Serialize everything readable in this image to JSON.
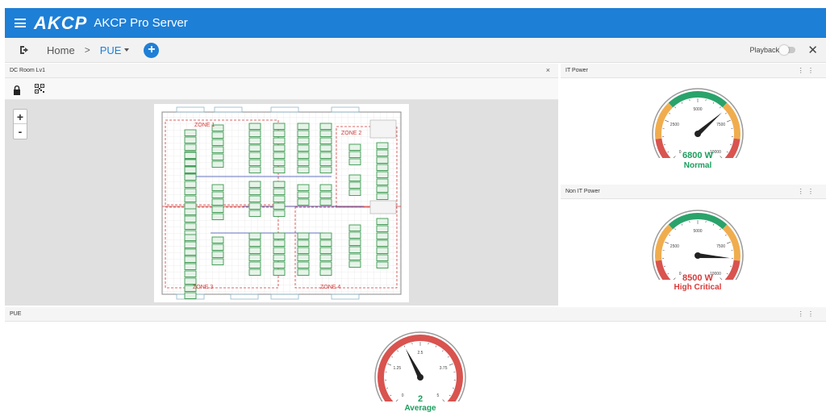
{
  "header": {
    "brand": "AKCP",
    "title": "AKCP Pro Server"
  },
  "nav": {
    "home": "Home",
    "separator": ">",
    "current": "PUE",
    "add_symbol": "+",
    "playback_label": "Playback",
    "close_symbol": "✕"
  },
  "map_panel": {
    "title": "DC Room Lv1",
    "close_symbol": "×",
    "zoom_in": "+",
    "zoom_out": "-",
    "zones": [
      "ZONE 1",
      "ZONE 2",
      "ZONE 3",
      "ZONE 4"
    ]
  },
  "it_power": {
    "title": "IT Power",
    "menu": "⋮ ⋮",
    "value_text": "6800 W",
    "status": "Normal",
    "value": 6800,
    "min": 0,
    "max": 10000,
    "ticks": [
      "0",
      "2500",
      "5000",
      "7500",
      "10000"
    ],
    "color_value": "#1a9e5c"
  },
  "non_it_power": {
    "title": "Non IT Power",
    "menu": "⋮ ⋮",
    "value_text": "8500 W",
    "status": "High Critical",
    "value": 8500,
    "min": 0,
    "max": 10000,
    "ticks": [
      "0",
      "2500",
      "5000",
      "7500",
      "10000"
    ],
    "color_value": "#d93a3a"
  },
  "pue": {
    "title": "PUE",
    "menu": "⋮ ⋮",
    "value_text": "2",
    "status": "Average",
    "value": 2,
    "min": 0,
    "max": 5,
    "ticks": [
      "0",
      "1.25",
      "2.5",
      "3.75",
      "5"
    ],
    "color_value": "#1a9e5c"
  },
  "colors": {
    "header_bg": "#1e7fd6",
    "gauge_red": "#d9534f",
    "gauge_yellow": "#f0ad4e",
    "gauge_green": "#2aa36b",
    "zone_red": "#d33a3a",
    "rack_green": "#3a9a4f"
  }
}
